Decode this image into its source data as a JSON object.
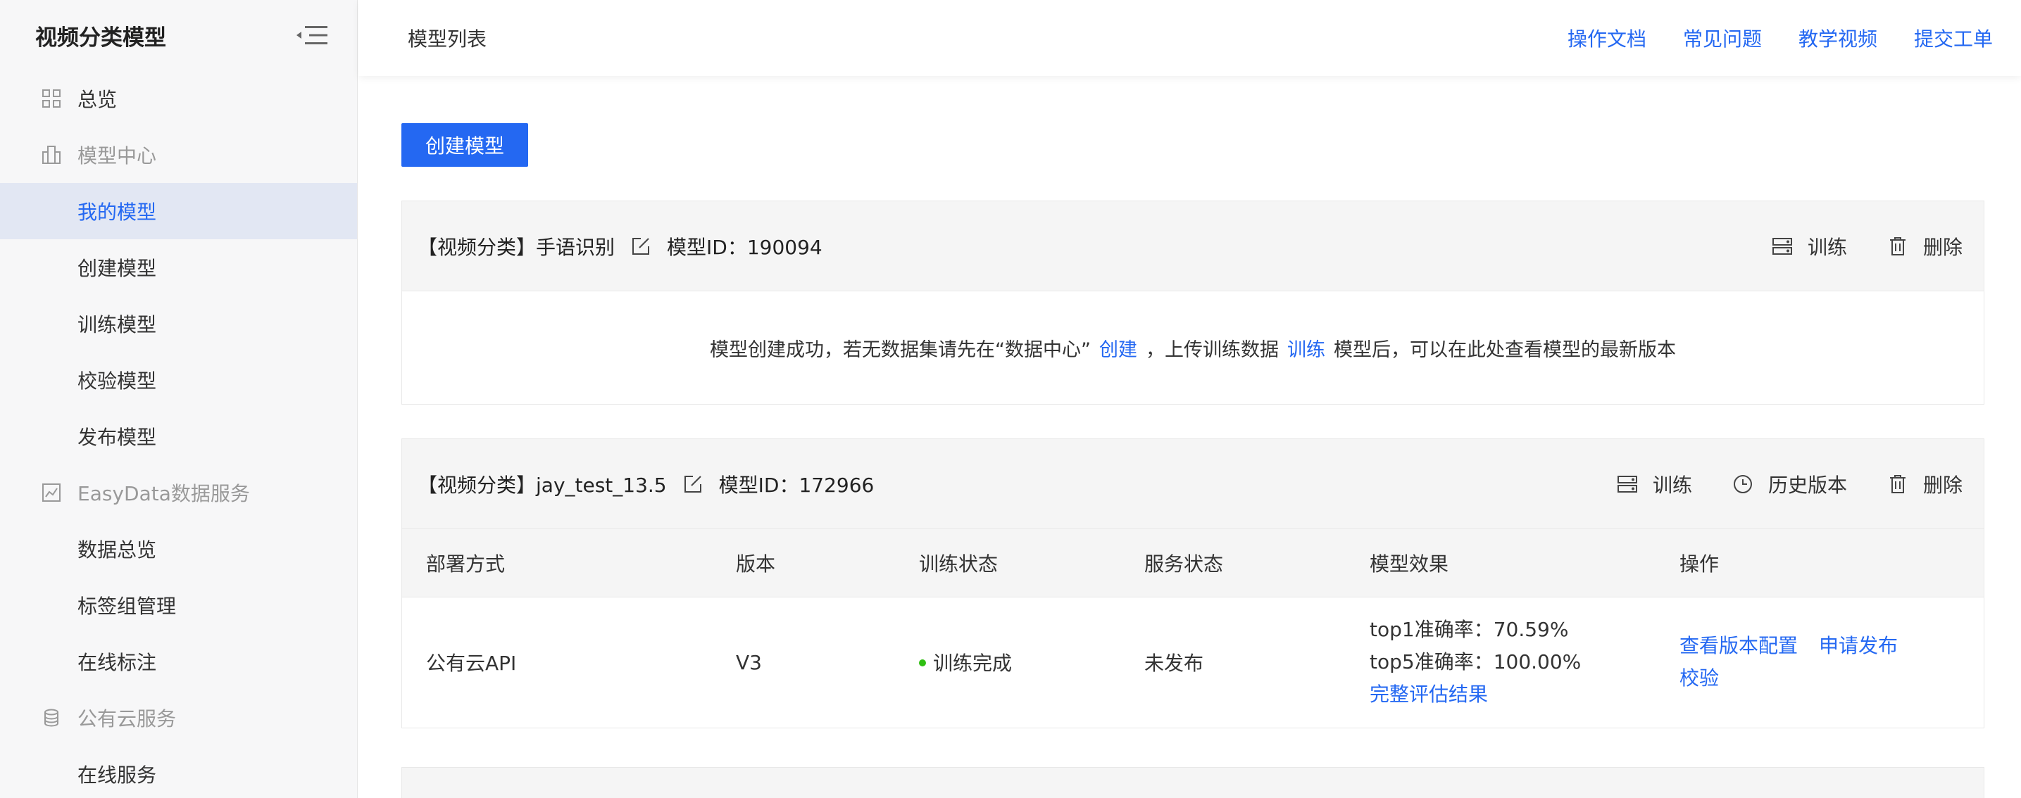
{
  "sidebar": {
    "title": "视频分类模型",
    "overview": "总览",
    "model_center": "模型中心",
    "my_models": "我的模型",
    "create_model": "创建模型",
    "train_model": "训练模型",
    "validate_model": "校验模型",
    "publish_model": "发布模型",
    "easydata": "EasyData数据服务",
    "data_overview": "数据总览",
    "tag_groups": "标签组管理",
    "online_labeling": "在线标注",
    "public_cloud": "公有云服务",
    "online_service": "在线服务"
  },
  "header": {
    "breadcrumb": "模型列表",
    "links": [
      "操作文档",
      "常见问题",
      "教学视频",
      "提交工单"
    ]
  },
  "main": {
    "create_button": "创建模型",
    "card1": {
      "title": "【视频分类】手语识别",
      "model_id": "模型ID：190094",
      "train": "训练",
      "delete": "删除",
      "msg_part1": "模型创建成功，若无数据集请先在“数据中心”",
      "msg_link1": "创建",
      "msg_part2": "，上传训练数据",
      "msg_link2": "训练",
      "msg_part3": "模型后，可以在此处查看模型的最新版本"
    },
    "card2": {
      "title": "【视频分类】jay_test_13.5",
      "model_id": "模型ID：172966",
      "train": "训练",
      "history": "历史版本",
      "delete": "删除",
      "columns": [
        "部署方式",
        "版本",
        "训练状态",
        "服务状态",
        "模型效果",
        "操作"
      ],
      "row": {
        "deploy": "公有云API",
        "version": "V3",
        "train_status": "训练完成",
        "service_status": "未发布",
        "top1": "top1准确率：70.59%",
        "top5": "top5准确率：100.00%",
        "full_eval": "完整评估结果",
        "op_view": "查看版本配置",
        "op_publish": "申请发布",
        "op_validate": "校验"
      }
    }
  },
  "colors": {
    "accent": "#2468f2",
    "success": "#30bf13"
  }
}
